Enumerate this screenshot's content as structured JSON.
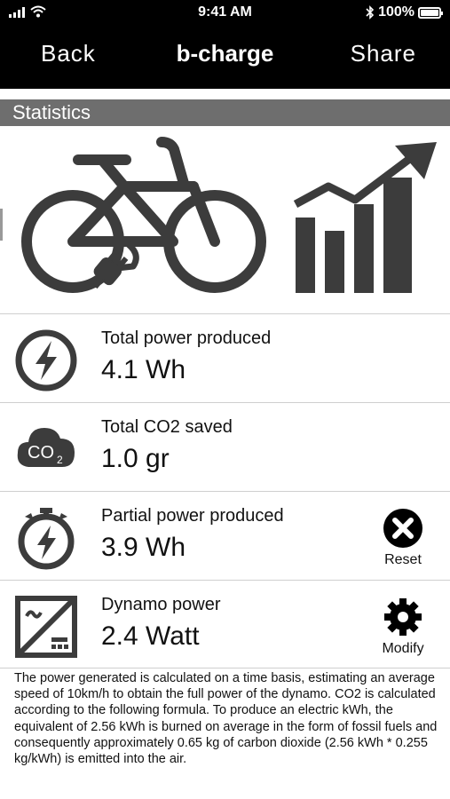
{
  "status_bar": {
    "time": "9:41 AM",
    "battery_text": "100%",
    "icons": [
      "signal-icon",
      "wifi-icon",
      "bluetooth-icon",
      "battery-icon"
    ]
  },
  "nav": {
    "back_label": "Back",
    "title": "b-charge",
    "share_label": "Share"
  },
  "section": {
    "title": "Statistics"
  },
  "stats": [
    {
      "icon": "lightning-circle-icon",
      "label": "Total power produced",
      "value": "4.1 Wh"
    },
    {
      "icon": "co2-cloud-icon",
      "label": "Total CO2 saved",
      "value": "1.0 gr"
    },
    {
      "icon": "stopwatch-lightning-icon",
      "label": "Partial power produced",
      "value": "3.9 Wh",
      "action": {
        "icon": "close-circle-icon",
        "label": "Reset"
      }
    },
    {
      "icon": "dynamo-icon",
      "label": "Dynamo power",
      "value": "2.4 Watt",
      "action": {
        "icon": "gear-icon",
        "label": "Modify"
      }
    }
  ],
  "footnote": "The power generated is calculated on a time basis, estimating an average speed of 10km/h to obtain the full power of the dynamo. CO2 is calculated according to the following formula. To produce an electric kWh, the equivalent of 2.56 kWh is burned on average in the form of fossil fuels and consequently approximately 0.65 kg of carbon dioxide (2.56 kWh * 0.255 kg/kWh) is emitted into the air.",
  "co2_icon_text": "CO",
  "co2_icon_sub": "2",
  "colors": {
    "header_bg": "#000000",
    "section_bg": "#6e6e6e",
    "icon_gray": "#3c3c3c",
    "divider": "#cfcfcf"
  }
}
